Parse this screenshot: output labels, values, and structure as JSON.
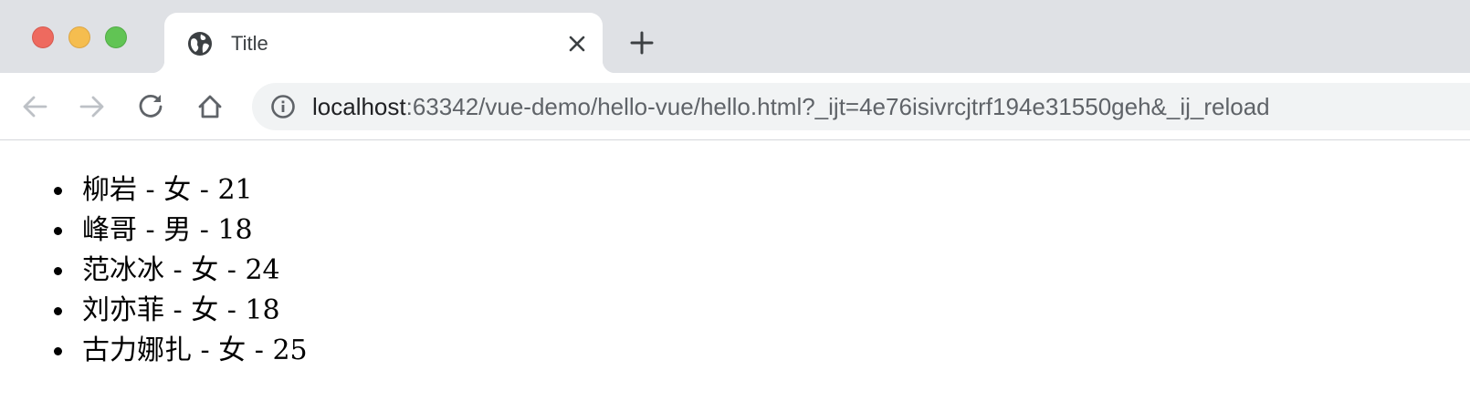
{
  "tab": {
    "title": "Title"
  },
  "address_bar": {
    "host": "localhost",
    "rest": ":63342/vue-demo/hello-vue/hello.html?_ijt=4e76isivrcjtrf194e31550geh&_ij_reload"
  },
  "people": [
    {
      "name": "柳岩",
      "gender": "女",
      "age": "21"
    },
    {
      "name": "峰哥",
      "gender": "男",
      "age": "18"
    },
    {
      "name": "范冰冰",
      "gender": "女",
      "age": "24"
    },
    {
      "name": "刘亦菲",
      "gender": "女",
      "age": "18"
    },
    {
      "name": "古力娜扎",
      "gender": "女",
      "age": "25"
    }
  ],
  "separator": " - ",
  "icons": {
    "favicon": "globe-icon",
    "tab_close": "close-icon",
    "new_tab": "plus-icon",
    "back": "arrow-left-icon",
    "forward": "arrow-right-icon",
    "reload": "reload-icon",
    "home": "home-icon",
    "site_info": "info-icon"
  },
  "colors": {
    "tabstrip": "#dfe1e5",
    "omnibox": "#f1f3f4",
    "close_light": "#ee6a5f",
    "minimize_light": "#f5bd4f",
    "maximize_light": "#61c454"
  }
}
